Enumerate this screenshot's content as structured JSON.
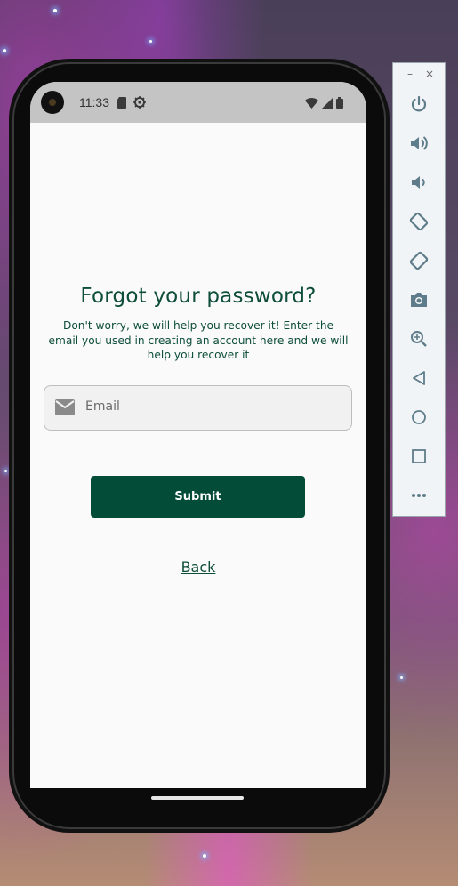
{
  "status_bar": {
    "time": "11:33"
  },
  "page": {
    "title": "Forgot your password?",
    "subtitle": "Don't worry, we will help you recover it! Enter the email you used in creating an account here and we will help you recover it",
    "email_placeholder": "Email",
    "email_value": "",
    "submit_label": "Submit",
    "back_label": "Back"
  },
  "toolbar": {
    "minimize_label": "–",
    "close_label": "×",
    "buttons": [
      "power-icon",
      "volume-up-icon",
      "volume-down-icon",
      "rotate-left-icon",
      "rotate-right-icon",
      "camera-icon",
      "zoom-icon",
      "back-icon",
      "home-icon",
      "overview-icon",
      "more-icon"
    ]
  },
  "colors": {
    "brand_green": "#034d38",
    "text_green": "#0d4d3a",
    "screen_bg": "#fafafa",
    "status_bar_bg": "#c4c4c4",
    "toolbar_icon": "#5f7c8a"
  }
}
